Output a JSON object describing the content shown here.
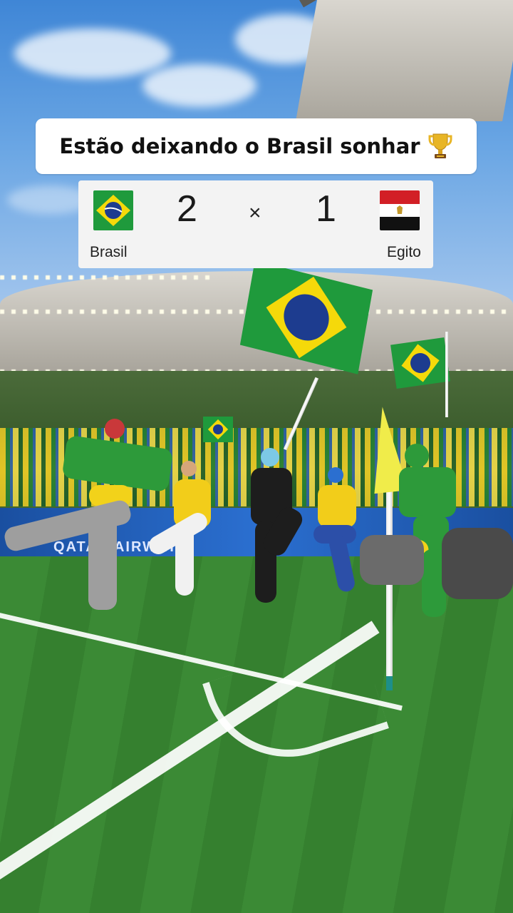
{
  "headline": {
    "text": "Estão deixando o Brasil sonhar",
    "icon": "trophy-emoji"
  },
  "scoreboard": {
    "home": {
      "name": "Brasil",
      "score": "2",
      "flag_icon": "brazil-flag-icon"
    },
    "separator": "×",
    "away": {
      "name": "Egito",
      "score": "1",
      "flag_icon": "egypt-flag-icon"
    }
  },
  "background": {
    "advertising_board_text": "QATAR AIRWAYS",
    "scene": "stadium-corner-celebration"
  },
  "colors": {
    "brazil_green": "#1f9a3c",
    "brazil_yellow": "#f5d90a",
    "brazil_blue": "#1d3c8f",
    "egypt_red": "#d21f26",
    "egypt_black": "#111111",
    "headline_bg": "#ffffff",
    "scorecard_bg": "#f3f3f3"
  }
}
